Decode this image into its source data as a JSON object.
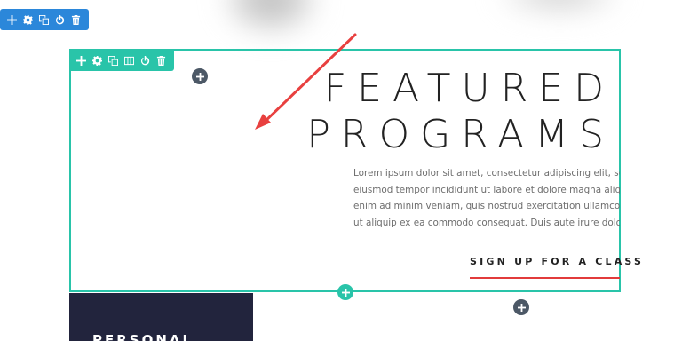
{
  "hero": {
    "title_lines": [
      "FEATURED",
      "PROGRAMS"
    ],
    "body_lines": [
      "Lorem ipsum dolor sit amet, consectetur adipiscing elit, sed do",
      "eiusmod tempor incididunt ut labore et dolore magna aliqua. Ut",
      "enim ad minim veniam, quis nostrud exercitation ullamco laboris nisi",
      "ut aliquip ex ea commodo consequat. Duis aute irure dolor"
    ],
    "cta_label": "SIGN UP FOR A CLASS"
  },
  "card": {
    "title": "PERSONAL"
  },
  "section_toolbar": {
    "icons": [
      "add-icon",
      "gear-icon",
      "duplicate-icon",
      "power-icon",
      "trash-icon"
    ]
  },
  "row_toolbar": {
    "icons": [
      "add-icon",
      "gear-icon",
      "duplicate-icon",
      "columns-icon",
      "power-icon",
      "trash-icon"
    ]
  },
  "colors": {
    "section_toolbar": "#2b87da",
    "row_toolbar": "#29c4a9",
    "round_button": "#4c5866",
    "cta_underline": "#e23b3b",
    "card_background": "#22243d",
    "annotation_arrow": "#e8403f"
  }
}
